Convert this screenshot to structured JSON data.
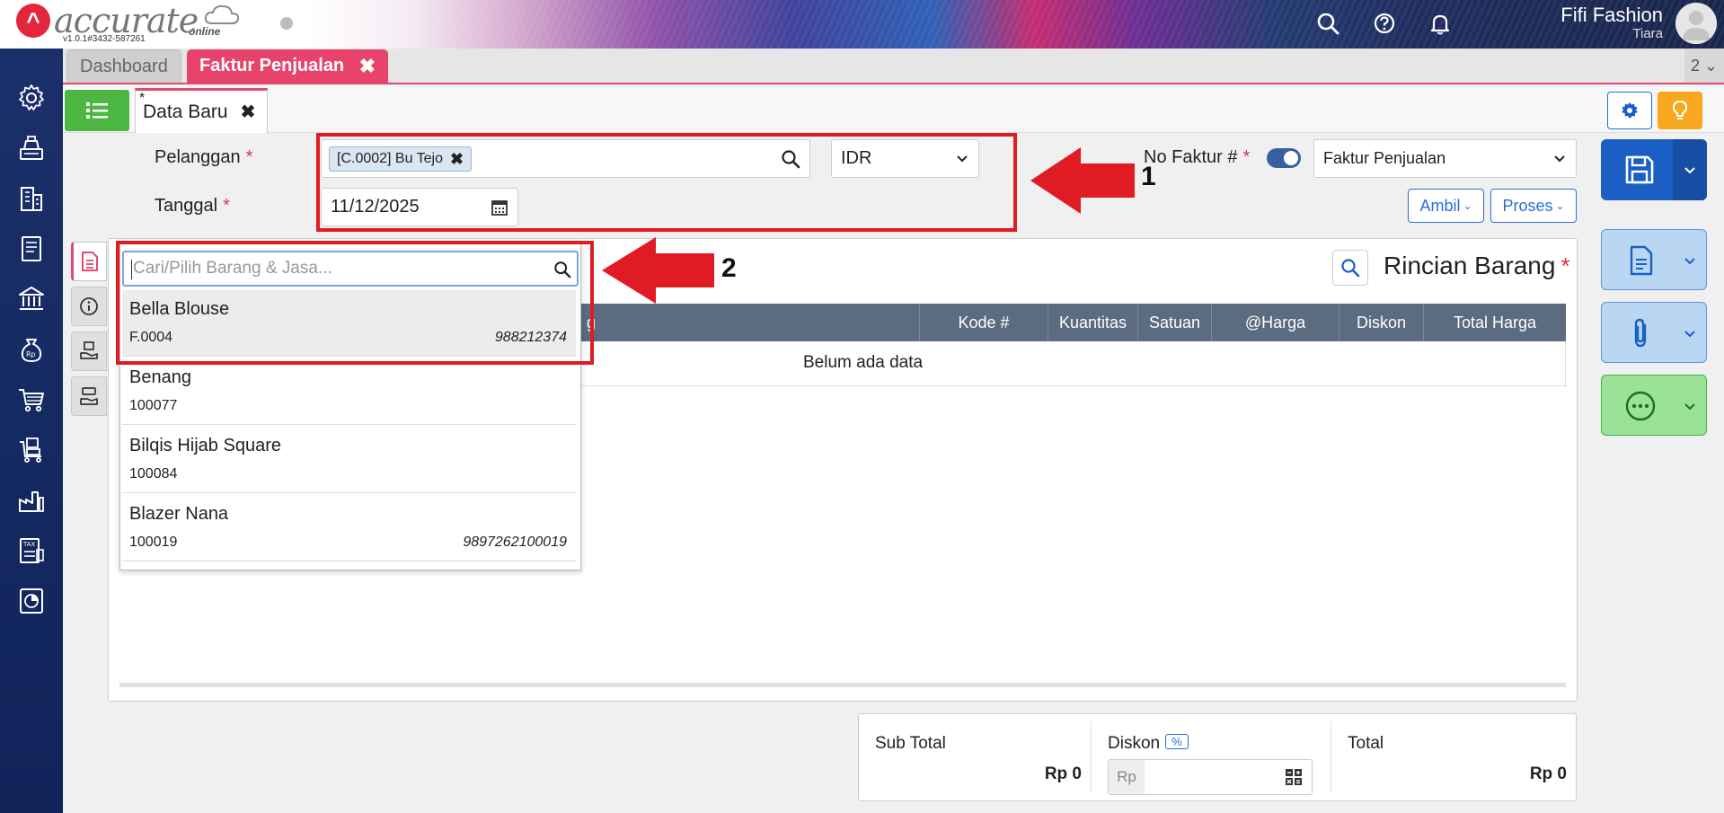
{
  "header": {
    "logo_mark": "^",
    "logo_text": "accurate",
    "logo_sub": "online",
    "version": "v1.0.1#3432-587261",
    "user_name": "Fifi Fashion",
    "user_role": "Tiara"
  },
  "tabs": {
    "dashboard": "Dashboard",
    "faktur": "Faktur Penjualan",
    "close_glyph": "✖",
    "count": "2 ⌄"
  },
  "subbar": {
    "data_tab_star": "*",
    "data_tab_label": "Data Baru",
    "data_tab_close": "✖"
  },
  "form": {
    "pelanggan_label": "Pelanggan",
    "required": "*",
    "pelanggan_chip": "[C.0002] Bu Tejo",
    "chip_close": "✖",
    "currency": "IDR",
    "tanggal_label": "Tanggal",
    "tanggal_value": "11/12/2025",
    "no_faktur_label": "No Faktur #",
    "faktur_type": "Faktur Penjualan",
    "ambil_label": "Ambil",
    "proses_label": "Proses"
  },
  "annotations": {
    "one": "1",
    "two": "2"
  },
  "rincian": {
    "title": "Rincian Barang",
    "required": "*",
    "columns": [
      "Kode #",
      "Kuantitas",
      "Satuan",
      "@Harga",
      "Diskon",
      "Total Harga"
    ],
    "hidden_col_fragment": "g",
    "empty_text": "Belum ada data"
  },
  "dropdown": {
    "placeholder": "Cari/Pilih Barang & Jasa...",
    "items": [
      {
        "name": "Bella Blouse",
        "code": "F.0004",
        "barcode": "988212374"
      },
      {
        "name": "Benang",
        "code": "100077",
        "barcode": ""
      },
      {
        "name": "Bilqis Hijab Square",
        "code": "100084",
        "barcode": ""
      },
      {
        "name": "Blazer Nana",
        "code": "100019",
        "barcode": "9897262100019"
      }
    ]
  },
  "totals": {
    "subtotal_label": "Sub Total",
    "subtotal_value": "Rp 0",
    "diskon_label": "Diskon",
    "diskon_badge": "%",
    "diskon_prefix": "Rp",
    "total_label": "Total",
    "total_value": "Rp 0"
  },
  "colors": {
    "accent_pink": "#e8436b",
    "primary_blue": "#1b5fc4",
    "annotation_red": "#e11b24",
    "sidebar_navy": "#1b2f6a"
  }
}
